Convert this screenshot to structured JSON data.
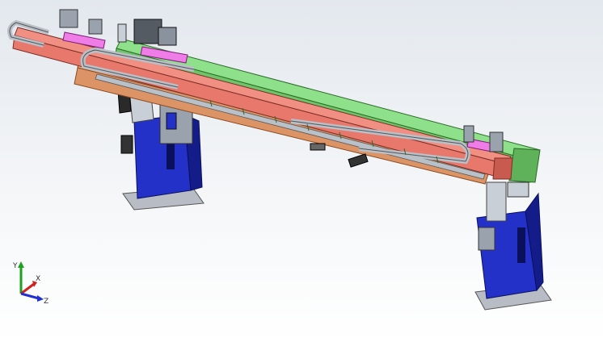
{
  "viewport": {
    "background_top": "#e3e8ee",
    "background_bottom": "#ffffff"
  },
  "colors": {
    "upper_beam": "#e8786b",
    "upper_beam_dark": "#c85a4f",
    "long_rail": "#8fe08a",
    "long_rail_dark": "#5fb25a",
    "lower_beam": "#f0a87a",
    "lower_beam_dark": "#c98358",
    "support_column": "#2431c8",
    "support_column_dark": "#141c8a",
    "base_plate": "#b8bcc4",
    "steel": "#b9c0c8",
    "magenta_part": "#f07ce8",
    "axis_x": "#d02020",
    "axis_y": "#20a020",
    "axis_z": "#2030d0"
  },
  "triad": {
    "x_label": "X",
    "y_label": "Y",
    "z_label": "Z"
  }
}
